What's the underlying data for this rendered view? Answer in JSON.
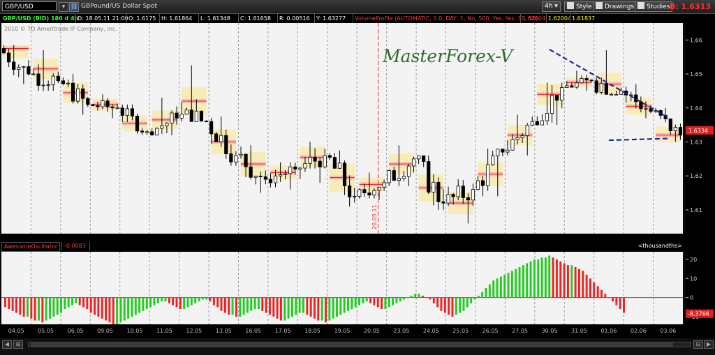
{
  "toolbar": {
    "symbol": "GBP/USD",
    "description": "GBPound/US Dollar Spot",
    "aggregation": "4h",
    "style_label": "Style",
    "drawings_label": "Drawings",
    "studies_label": "Studies",
    "bid_label": "B: 1.6313"
  },
  "infobar": {
    "title": "GBP/USD (BID) 180 d 4h",
    "date": "D: 18.05.11 21:00",
    "open": "O: 1.6175",
    "high": "H: 1.61864",
    "low": "L: 1.61348",
    "close": "C: 1.61658",
    "range": "R: 0.00516",
    "y": "Y: 1.63277",
    "volume_profile": "VolumeProfile (AUTOMATIC, 1.0, DAY, 1, No, 500, Yes, Yes, 70, 50)",
    "vp_value1": "1.62004",
    "vp_value2": "1.62004",
    "vp_value3": "1.61837"
  },
  "copyright": "2010 © TD Ameritrade IP Company, Inc.",
  "watermark": "MasterForex-V",
  "colors": {
    "background": "#f3f3f3",
    "bull_candle": "#ffffff",
    "bear_candle": "#000000",
    "osc_up": "#22cc22",
    "osc_down": "#ee2222",
    "trendline": "#1a2a9a",
    "vp_highlight": "#ffe04a",
    "vp_poc": "#e02020"
  },
  "chart_data": [
    {
      "type": "candlestick",
      "price_axis_ticks": [
        "1.66",
        "1.65",
        "1.64",
        "1.63",
        "1.62",
        "1.61"
      ],
      "ylim": [
        1.603,
        1.665
      ],
      "current_price_label": "1.6334",
      "x_tick_labels": [
        "04.05",
        "05.05",
        "06.05",
        "09.05",
        "10.05",
        "11.05",
        "12.05",
        "13.05",
        "16.05",
        "17.05",
        "18.05",
        "19.05",
        "20.05",
        "23.05",
        "24.05",
        "25.05",
        "26.05",
        "27.05",
        "30.05",
        "31.05",
        "01.06",
        "02.06",
        "03.06"
      ],
      "vertical_marker": "20.05.11",
      "daily_sessions": [
        {
          "day": "04.05",
          "open": 1.6575,
          "high": 1.6585,
          "low": 1.647,
          "close": 1.65,
          "poc": 1.6575
        },
        {
          "day": "05.05",
          "open": 1.65,
          "high": 1.657,
          "low": 1.645,
          "close": 1.648,
          "poc": 1.6515
        },
        {
          "day": "06.05",
          "open": 1.648,
          "high": 1.65,
          "low": 1.638,
          "close": 1.641,
          "poc": 1.6445
        },
        {
          "day": "09.05",
          "open": 1.641,
          "high": 1.644,
          "low": 1.637,
          "close": 1.64,
          "poc": 1.641
        },
        {
          "day": "10.05",
          "open": 1.64,
          "high": 1.641,
          "low": 1.632,
          "close": 1.633,
          "poc": 1.6355
        },
        {
          "day": "11.05",
          "open": 1.633,
          "high": 1.643,
          "low": 1.632,
          "close": 1.637,
          "poc": 1.6365
        },
        {
          "day": "12.05",
          "open": 1.637,
          "high": 1.6525,
          "low": 1.636,
          "close": 1.636,
          "poc": 1.642
        },
        {
          "day": "13.05",
          "open": 1.636,
          "high": 1.6375,
          "low": 1.623,
          "close": 1.626,
          "poc": 1.63
        },
        {
          "day": "16.05",
          "open": 1.626,
          "high": 1.629,
          "low": 1.615,
          "close": 1.619,
          "poc": 1.6235
        },
        {
          "day": "17.05",
          "open": 1.619,
          "high": 1.624,
          "low": 1.616,
          "close": 1.622,
          "poc": 1.621
        },
        {
          "day": "18.05",
          "open": 1.622,
          "high": 1.63,
          "low": 1.618,
          "close": 1.626,
          "poc": 1.6255
        },
        {
          "day": "19.05",
          "open": 1.626,
          "high": 1.6275,
          "low": 1.611,
          "close": 1.614,
          "poc": 1.6195
        },
        {
          "day": "20.05",
          "open": 1.614,
          "high": 1.621,
          "low": 1.613,
          "close": 1.618,
          "poc": 1.6175
        },
        {
          "day": "23.05",
          "open": 1.618,
          "high": 1.629,
          "low": 1.617,
          "close": 1.625,
          "poc": 1.6235
        },
        {
          "day": "24.05",
          "open": 1.625,
          "high": 1.626,
          "low": 1.61,
          "close": 1.612,
          "poc": 1.6165
        },
        {
          "day": "25.05",
          "open": 1.612,
          "high": 1.619,
          "low": 1.606,
          "close": 1.616,
          "poc": 1.612
        },
        {
          "day": "26.05",
          "open": 1.616,
          "high": 1.628,
          "low": 1.614,
          "close": 1.627,
          "poc": 1.6205
        },
        {
          "day": "27.05",
          "open": 1.627,
          "high": 1.638,
          "low": 1.626,
          "close": 1.636,
          "poc": 1.632
        },
        {
          "day": "30.05",
          "open": 1.636,
          "high": 1.6475,
          "low": 1.635,
          "close": 1.646,
          "poc": 1.644
        },
        {
          "day": "31.05",
          "open": 1.646,
          "high": 1.651,
          "low": 1.645,
          "close": 1.648,
          "poc": 1.6475
        },
        {
          "day": "01.06",
          "open": 1.648,
          "high": 1.657,
          "low": 1.644,
          "close": 1.645,
          "poc": 1.647
        },
        {
          "day": "02.06",
          "open": 1.645,
          "high": 1.647,
          "low": 1.637,
          "close": 1.639,
          "poc": 1.6405
        },
        {
          "day": "03.06",
          "open": 1.639,
          "high": 1.64,
          "low": 1.63,
          "close": 1.632,
          "poc": 1.632
        }
      ],
      "trendlines": [
        {
          "from": {
            "day": "30.05",
            "price": 1.6572
          },
          "to": {
            "day": "03.06",
            "price": 1.6372
          },
          "style": "dashed"
        },
        {
          "from": {
            "day": "01.06",
            "price": 1.6305
          },
          "to": {
            "day": "03.06",
            "price": 1.631
          },
          "style": "dashed"
        }
      ]
    },
    {
      "type": "bar",
      "name": "AwesomeOscillator",
      "value_label": "-0.0083",
      "units_label": "<thousandths>",
      "current_value_label": "-8.3766",
      "y_ticks": [
        "20",
        "10",
        "0",
        "-10"
      ],
      "ylim": [
        -14,
        24
      ],
      "values": [
        -5,
        -6,
        -7,
        -8,
        -9,
        -10,
        -10,
        -11,
        -12,
        -12,
        -13,
        -12,
        -11,
        -10,
        -9,
        -8,
        -6,
        -5,
        -4,
        -3,
        -4,
        -5,
        -6,
        -8,
        -9,
        -10,
        -11,
        -12,
        -13,
        -14,
        -14,
        -13,
        -12,
        -11,
        -10,
        -9,
        -8,
        -7,
        -6,
        -5,
        -4,
        -3,
        -2,
        -2,
        -3,
        -4,
        -5,
        -6,
        -6,
        -5,
        -4,
        -3,
        -2,
        -1,
        -1,
        -2,
        -4,
        -5,
        -7,
        -8,
        -9,
        -9,
        -10,
        -10,
        -9,
        -8,
        -7,
        -6,
        -6,
        -7,
        -8,
        -9,
        -10,
        -11,
        -12,
        -12,
        -11,
        -10,
        -9,
        -8,
        -8,
        -9,
        -10,
        -11,
        -12,
        -12,
        -13,
        -12,
        -11,
        -10,
        -9,
        -8,
        -7,
        -6,
        -5,
        -4,
        -3,
        -2,
        -3,
        -4,
        -5,
        -6,
        -6,
        -5,
        -4,
        -3,
        -2,
        -1,
        0,
        1,
        2,
        2,
        1,
        0,
        -1,
        -3,
        -5,
        -7,
        -8,
        -9,
        -10,
        -9,
        -8,
        -7,
        -5,
        -3,
        -1,
        1,
        3,
        5,
        7,
        9,
        10,
        11,
        12,
        13,
        14,
        15,
        16,
        17,
        18,
        19,
        20,
        20,
        21,
        21,
        22,
        21,
        20,
        19,
        18,
        17,
        17,
        16,
        15,
        14,
        12,
        10,
        8,
        6,
        4,
        2,
        0,
        -2,
        -4,
        -6,
        -8
      ],
      "colors_by_change": true
    }
  ]
}
